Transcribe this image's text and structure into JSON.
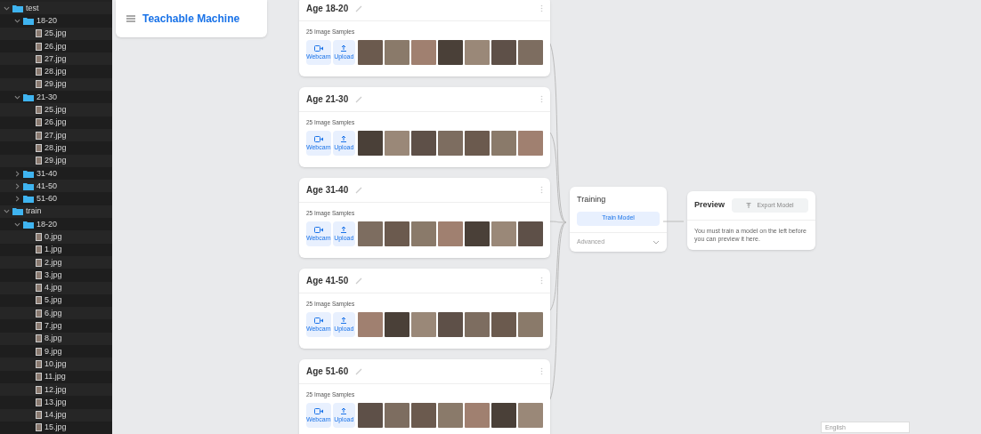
{
  "file_tree": [
    {
      "name": "test",
      "kind": "folder",
      "expanded": true,
      "children": [
        {
          "name": "18-20",
          "kind": "folder",
          "expanded": true,
          "children": [
            {
              "name": "25.jpg",
              "kind": "file"
            },
            {
              "name": "26.jpg",
              "kind": "file"
            },
            {
              "name": "27.jpg",
              "kind": "file"
            },
            {
              "name": "28.jpg",
              "kind": "file"
            },
            {
              "name": "29.jpg",
              "kind": "file"
            }
          ]
        },
        {
          "name": "21-30",
          "kind": "folder",
          "expanded": true,
          "children": [
            {
              "name": "25.jpg",
              "kind": "file"
            },
            {
              "name": "26.jpg",
              "kind": "file"
            },
            {
              "name": "27.jpg",
              "kind": "file"
            },
            {
              "name": "28.jpg",
              "kind": "file"
            },
            {
              "name": "29.jpg",
              "kind": "file"
            }
          ]
        },
        {
          "name": "31-40",
          "kind": "folder",
          "expanded": false
        },
        {
          "name": "41-50",
          "kind": "folder",
          "expanded": false
        },
        {
          "name": "51-60",
          "kind": "folder",
          "expanded": false
        }
      ]
    },
    {
      "name": "train",
      "kind": "folder",
      "expanded": true,
      "children": [
        {
          "name": "18-20",
          "kind": "folder",
          "expanded": true,
          "children": [
            {
              "name": "0.jpg",
              "kind": "file"
            },
            {
              "name": "1.jpg",
              "kind": "file"
            },
            {
              "name": "2.jpg",
              "kind": "file"
            },
            {
              "name": "3.jpg",
              "kind": "file"
            },
            {
              "name": "4.jpg",
              "kind": "file"
            },
            {
              "name": "5.jpg",
              "kind": "file"
            },
            {
              "name": "6.jpg",
              "kind": "file"
            },
            {
              "name": "7.jpg",
              "kind": "file"
            },
            {
              "name": "8.jpg",
              "kind": "file"
            },
            {
              "name": "9.jpg",
              "kind": "file"
            },
            {
              "name": "10.jpg",
              "kind": "file"
            },
            {
              "name": "11.jpg",
              "kind": "file"
            },
            {
              "name": "12.jpg",
              "kind": "file"
            },
            {
              "name": "13.jpg",
              "kind": "file"
            },
            {
              "name": "14.jpg",
              "kind": "file"
            },
            {
              "name": "15.jpg",
              "kind": "file"
            }
          ]
        }
      ]
    }
  ],
  "header": {
    "title": "Teachable Machine"
  },
  "classes": [
    {
      "name": "Age 18-20",
      "samples": "25 Image Samples",
      "webcam": "Webcam",
      "upload": "Upload"
    },
    {
      "name": "Age 21-30",
      "samples": "25 Image Samples",
      "webcam": "Webcam",
      "upload": "Upload"
    },
    {
      "name": "Age 31-40",
      "samples": "25 Image Samples",
      "webcam": "Webcam",
      "upload": "Upload"
    },
    {
      "name": "Age 41-50",
      "samples": "25 Image Samples",
      "webcam": "Webcam",
      "upload": "Upload"
    },
    {
      "name": "Age 51-60",
      "samples": "25 Image Samples",
      "webcam": "Webcam",
      "upload": "Upload"
    }
  ],
  "training": {
    "title": "Training",
    "button": "Train Model",
    "advanced": "Advanced",
    "expanded": false
  },
  "preview": {
    "title": "Preview",
    "export_button": "Export Model",
    "message": "You must train a model on the left before you can preview it here."
  },
  "footer": {
    "language": "English"
  }
}
